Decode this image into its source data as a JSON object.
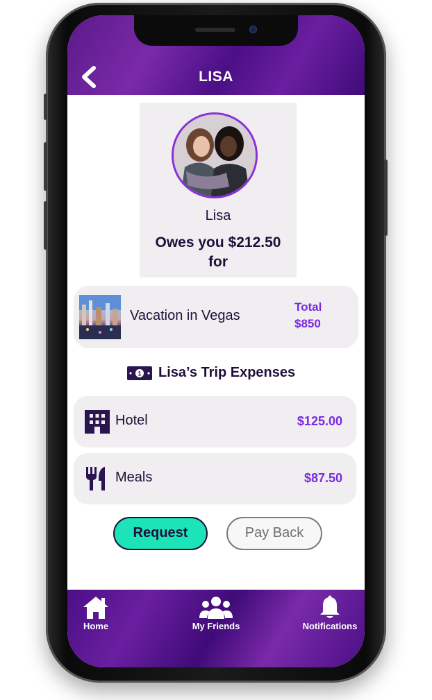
{
  "header": {
    "title": "LISA"
  },
  "profile": {
    "name": "Lisa",
    "owes_text": "Owes you $212.50",
    "for_text": "for"
  },
  "trip": {
    "title": "Vacation in Vegas",
    "total_label": "Total",
    "total_value": "$850"
  },
  "expenses_section": {
    "title": "Lisa’s Trip Expenses",
    "icon": "money-bill-icon"
  },
  "expenses": [
    {
      "label": "Hotel",
      "amount": "$125.00",
      "icon": "hotel-icon"
    },
    {
      "label": "Meals",
      "amount": "$87.50",
      "icon": "utensils-icon"
    }
  ],
  "actions": {
    "request_label": "Request",
    "payback_label": "Pay Back"
  },
  "tabs": [
    {
      "label": "Home",
      "icon": "home-icon"
    },
    {
      "label": "My Friends",
      "icon": "friends-icon"
    },
    {
      "label": "Notifications",
      "icon": "bell-icon"
    }
  ],
  "colors": {
    "brand_purple": "#6a1fa0",
    "accent_purple": "#7a2ae0",
    "request_green": "#1de3b8",
    "text_dark": "#1e0f3a",
    "card_bg": "#f0eef1"
  }
}
